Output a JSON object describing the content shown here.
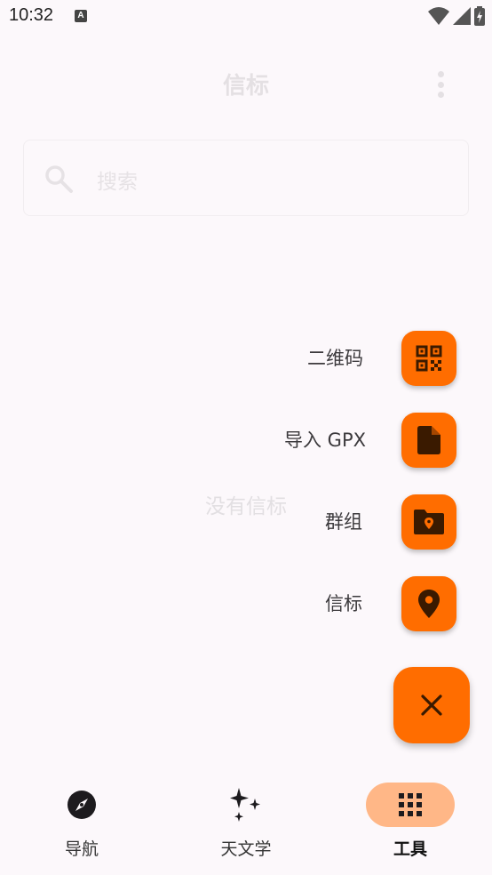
{
  "status_bar": {
    "time": "10:32",
    "notification_icon": "a-icon",
    "wifi_icon": "wifi-icon",
    "signal_icon": "signal-icon",
    "battery_icon": "battery-charging-icon"
  },
  "header": {
    "title": "信标",
    "menu_icon": "more-vert-icon"
  },
  "search": {
    "placeholder": "搜索",
    "icon": "search-icon"
  },
  "empty_state": "没有信标",
  "speed_dial": {
    "items": [
      {
        "label": "二维码",
        "icon": "qr-code-icon"
      },
      {
        "label": "导入 GPX",
        "icon": "file-icon"
      },
      {
        "label": "群组",
        "icon": "folder-location-icon"
      },
      {
        "label": "信标",
        "icon": "location-pin-icon"
      }
    ],
    "close_icon": "close-icon",
    "accent": "#ff6d00"
  },
  "bottom_nav": {
    "items": [
      {
        "label": "导航",
        "icon": "compass-icon",
        "active": false
      },
      {
        "label": "天文学",
        "icon": "sparkle-icon",
        "active": false
      },
      {
        "label": "工具",
        "icon": "grid-icon",
        "active": true
      }
    ],
    "active_indicator": "#ffb787"
  }
}
